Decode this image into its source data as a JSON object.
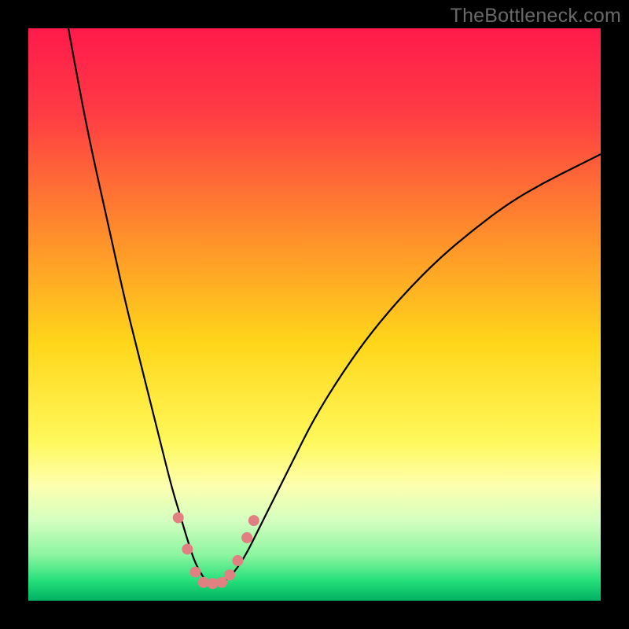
{
  "watermark": "TheBottleneck.com",
  "chart_data": {
    "type": "line",
    "title": "",
    "xlabel": "",
    "ylabel": "",
    "xlim": [
      0,
      100
    ],
    "ylim": [
      0,
      100
    ],
    "background_gradient": {
      "stops": [
        {
          "offset": 0.0,
          "color": "#ff1a4b"
        },
        {
          "offset": 0.15,
          "color": "#ff3c44"
        },
        {
          "offset": 0.35,
          "color": "#ff8a2c"
        },
        {
          "offset": 0.55,
          "color": "#ffd61a"
        },
        {
          "offset": 0.72,
          "color": "#fff85a"
        },
        {
          "offset": 0.8,
          "color": "#fdffb0"
        },
        {
          "offset": 0.86,
          "color": "#d4ffc0"
        },
        {
          "offset": 0.92,
          "color": "#8cf5a0"
        },
        {
          "offset": 0.965,
          "color": "#25e07a"
        },
        {
          "offset": 1.0,
          "color": "#00b060"
        }
      ]
    },
    "series": [
      {
        "name": "curve",
        "color": "#000000",
        "width": 2.2,
        "x": [
          7,
          9,
          11,
          13,
          15,
          17,
          19,
          21,
          23,
          25,
          26.5,
          28,
          29,
          30,
          31,
          32,
          33,
          34.5,
          36,
          38,
          40,
          43,
          46,
          50,
          55,
          60,
          66,
          72,
          78,
          84,
          90,
          96,
          100
        ],
        "y": [
          100,
          89,
          79,
          70,
          61,
          52,
          44,
          36,
          28,
          20,
          15,
          10,
          7,
          5,
          3.5,
          3,
          3,
          3.5,
          5,
          8,
          12,
          18,
          24,
          32,
          40,
          47,
          54,
          60,
          65,
          69.5,
          73,
          76,
          78
        ]
      }
    ],
    "markers": {
      "name": "highlight-dots",
      "color": "#e08080",
      "radius": 7,
      "points": [
        {
          "x": 26.2,
          "y": 14.5
        },
        {
          "x": 27.8,
          "y": 9.0
        },
        {
          "x": 29.2,
          "y": 5.0
        },
        {
          "x": 30.6,
          "y": 3.2
        },
        {
          "x": 32.2,
          "y": 3.0
        },
        {
          "x": 33.8,
          "y": 3.2
        },
        {
          "x": 35.2,
          "y": 4.5
        },
        {
          "x": 36.6,
          "y": 7.0
        },
        {
          "x": 38.2,
          "y": 11.0
        },
        {
          "x": 39.4,
          "y": 14.0
        }
      ]
    }
  }
}
